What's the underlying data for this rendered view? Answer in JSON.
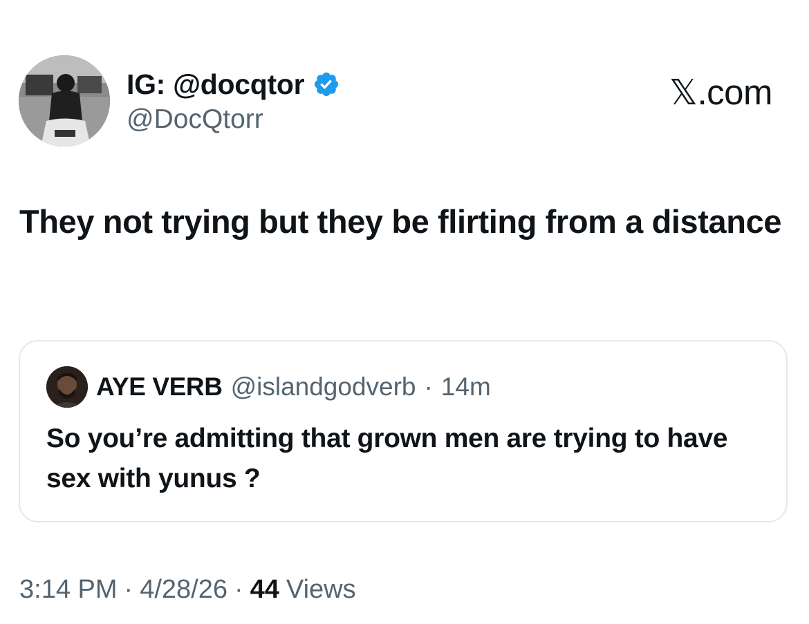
{
  "author": {
    "display_name": "IG: @docqtor",
    "handle": "@DocQtorr",
    "verified": true,
    "verified_color": "#1d9bf0"
  },
  "brand": {
    "label": "𝕏.com"
  },
  "tweet": {
    "text": "They not trying but they be flirting from a distance"
  },
  "quoted_tweet": {
    "display_name": "AYE VERB",
    "handle": "@islandgodverb",
    "separator": "·",
    "time": "14m",
    "text": "So you’re admitting that grown men are trying to have sex with yunus ?"
  },
  "meta": {
    "time": "3:14 PM",
    "separator": "·",
    "date": "4/28/26",
    "views_count": "44",
    "views_label": "Views"
  },
  "colors": {
    "text_primary": "#0f1419",
    "text_secondary": "#536471",
    "border": "#e3e8ec"
  }
}
